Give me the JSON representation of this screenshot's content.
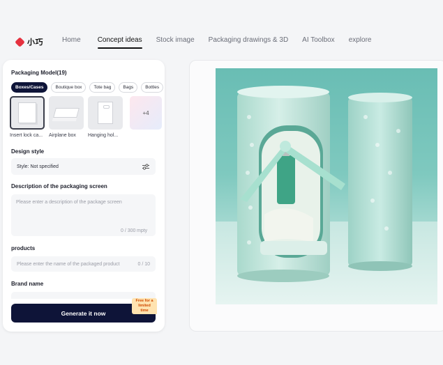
{
  "brand": {
    "logo_text": "小巧"
  },
  "nav": {
    "items": [
      {
        "label": "Home",
        "active": false
      },
      {
        "label": "Concept ideas",
        "active": true
      },
      {
        "label": "Stock image",
        "active": false
      },
      {
        "label": "Packaging drawings & 3D",
        "active": false
      },
      {
        "label": "AI Toolbox",
        "active": false
      },
      {
        "label": "explore",
        "active": false
      }
    ]
  },
  "panel": {
    "model_title": "Packaging Model(19)",
    "chips": [
      {
        "label": "Boxes/Cases",
        "active": true
      },
      {
        "label": "Boutique box",
        "active": false
      },
      {
        "label": "Tote bag",
        "active": false
      },
      {
        "label": "Bags",
        "active": false
      },
      {
        "label": "Bottles",
        "active": false
      }
    ],
    "models": [
      {
        "label": "Insert lock ca...",
        "icon": "insert-lock-box-icon"
      },
      {
        "label": "Airplane box",
        "icon": "airplane-box-icon"
      },
      {
        "label": "Hanging hol...",
        "icon": "hanging-box-icon"
      }
    ],
    "more_label": "+4",
    "design_style_title": "Design style",
    "design_style_value": "Style: Not specified",
    "description_title": "Description of the packaging screen",
    "description_placeholder": "Please enter a description of the package screen",
    "description_counter": "0 / 300",
    "description_empty": "mpty",
    "products_title": "products",
    "products_placeholder": "Please enter the name of the packaged product",
    "products_counter": "0 / 10",
    "brand_title": "Brand name",
    "generate_label": "Generate it now",
    "promo_label": "Free for a limited time"
  },
  "colors": {
    "accent": "#0e1438",
    "logo_red": "#e5313f",
    "preview_bg": "#7fc9bf"
  }
}
